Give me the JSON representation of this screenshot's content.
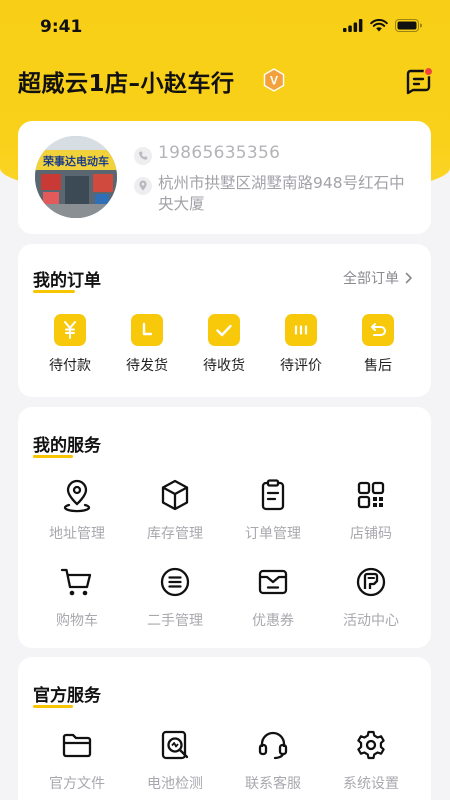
{
  "status_bar": {
    "time": "9:41"
  },
  "header": {
    "store_name": "超威云1店–小赵车行",
    "vip_badge": "V"
  },
  "profile": {
    "phone": "19865635356",
    "address": "杭州市拱墅区湖墅南路948号红石中央大厦",
    "storefront_sign": "荣事达电动车"
  },
  "orders": {
    "title": "我的订单",
    "all_link": "全部订单",
    "items": [
      {
        "label": "待付款",
        "icon": "yen-icon"
      },
      {
        "label": "待发货",
        "icon": "ship-icon"
      },
      {
        "label": "待收货",
        "icon": "check-icon"
      },
      {
        "label": "待评价",
        "icon": "comment-icon"
      },
      {
        "label": "售后",
        "icon": "return-icon"
      }
    ]
  },
  "services": {
    "title": "我的服务",
    "items": [
      {
        "label": "地址管理",
        "icon": "location-icon"
      },
      {
        "label": "库存管理",
        "icon": "box-icon"
      },
      {
        "label": "订单管理",
        "icon": "clipboard-icon"
      },
      {
        "label": "店铺码",
        "icon": "qr-code-icon"
      },
      {
        "label": "购物车",
        "icon": "cart-icon"
      },
      {
        "label": "二手管理",
        "icon": "list-circle-icon"
      },
      {
        "label": "优惠券",
        "icon": "coupon-icon"
      },
      {
        "label": "活动中心",
        "icon": "activity-icon"
      }
    ]
  },
  "official": {
    "title": "官方服务",
    "items": [
      {
        "label": "官方文件",
        "icon": "folder-icon"
      },
      {
        "label": "电池检测",
        "icon": "battery-check-icon"
      },
      {
        "label": "联系客服",
        "icon": "headset-icon"
      },
      {
        "label": "系统设置",
        "icon": "settings-gear-icon"
      }
    ]
  },
  "colors": {
    "accent": "#F8C90A",
    "header_bg": "#F9D11A",
    "badge_dot": "#F0463C",
    "muted_text": "#A8A8AE"
  }
}
